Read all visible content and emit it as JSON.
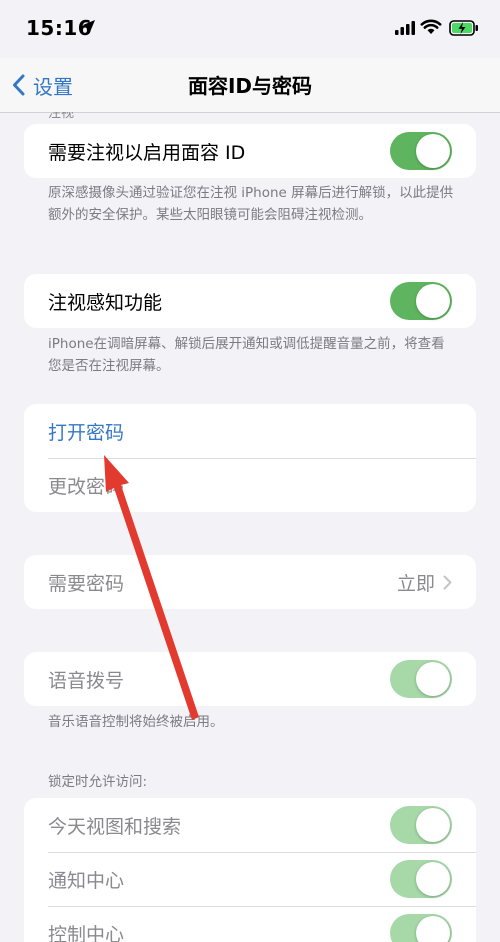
{
  "status_bar": {
    "time": "15:16"
  },
  "nav": {
    "back_label": "设置",
    "title": "面容ID与密码"
  },
  "attention": {
    "partial_header": "注视",
    "require_attention_label": "需要注视以启用面容 ID",
    "require_attention_on": true,
    "require_attention_note": "原深感摄像头通过验证您在注视 iPhone 屏幕后进行解锁，以此提供额外的安全保护。某些太阳眼镜可能会阻碍注视检测。",
    "attention_aware_label": "注视感知功能",
    "attention_aware_on": true,
    "attention_aware_note": "iPhone在调暗屏幕、解锁后展开通知或调低提醒音量之前，将查看您是否在注视屏幕。"
  },
  "passcode": {
    "turn_on_label": "打开密码",
    "change_label": "更改密码"
  },
  "require_passcode": {
    "label": "需要密码",
    "value": "立即"
  },
  "voice_dial": {
    "label": "语音拨号",
    "on": true,
    "note": "音乐语音控制将始终被启用。"
  },
  "locked_access": {
    "header": "锁定时允许访问:",
    "items": [
      {
        "label": "今天视图和搜索",
        "on": true
      },
      {
        "label": "通知中心",
        "on": true
      },
      {
        "label": "控制中心",
        "on": true
      }
    ]
  },
  "colors": {
    "accent": "#3577c7",
    "toggle_on": "#5fb55f",
    "arrow": "#e23a2e"
  }
}
